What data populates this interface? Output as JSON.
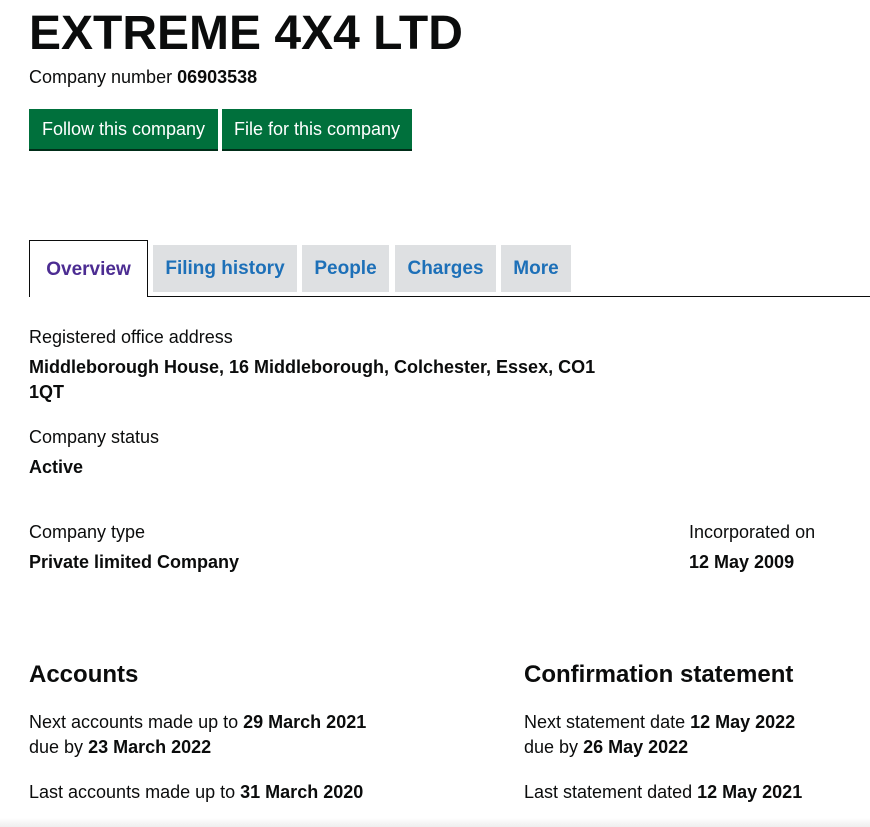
{
  "header": {
    "company_name": "EXTREME 4X4 LTD",
    "company_number_label": "Company number",
    "company_number": "06903538"
  },
  "actions": {
    "follow_label": "Follow this company",
    "file_label": "File for this company"
  },
  "tabs": [
    {
      "label": "Overview",
      "active": true
    },
    {
      "label": "Filing history",
      "active": false
    },
    {
      "label": "People",
      "active": false
    },
    {
      "label": "Charges",
      "active": false
    },
    {
      "label": "More",
      "active": false
    }
  ],
  "overview": {
    "address_label": "Registered office address",
    "address_line1": "Middleborough House, 16 Middleborough, Colchester, Essex, CO1",
    "address_line2": "1QT",
    "status_label": "Company status",
    "status_value": "Active",
    "type_label": "Company type",
    "type_value": "Private limited Company",
    "incorporated_label": "Incorporated on",
    "incorporated_value": "12 May 2009"
  },
  "accounts": {
    "heading": "Accounts",
    "next_prefix": "Next accounts made up to",
    "next_date": "29 March 2021",
    "due_prefix": "due by",
    "due_date": "23 March 2022",
    "last_prefix": "Last accounts made up to",
    "last_date": "31 March 2020"
  },
  "confirmation": {
    "heading": "Confirmation statement",
    "next_prefix": "Next statement date",
    "next_date": "12 May 2022",
    "due_prefix": "due by",
    "due_date": "26 May 2022",
    "last_prefix": "Last statement dated",
    "last_date": "12 May 2021"
  },
  "colors": {
    "button_green": "#00703c",
    "link_blue": "#1d70b8",
    "active_tab_purple": "#4c2c92",
    "tab_grey": "#dee0e2",
    "text": "#0b0c0c"
  }
}
